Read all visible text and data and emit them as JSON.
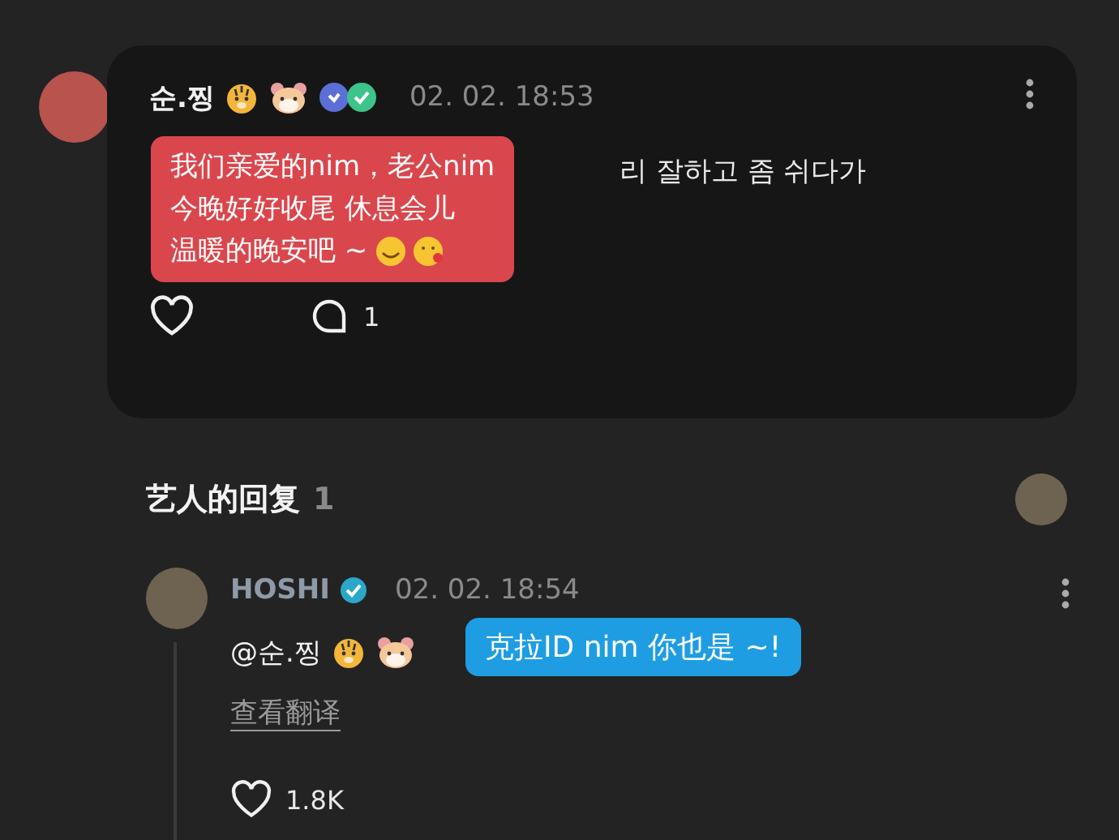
{
  "comment": {
    "author": "순.찡",
    "time": "02. 02. 18:53",
    "text_visible": "리 잘하고 좀 쉬다가",
    "translation_overlay": [
      "我们亲爱的nim，老公nim",
      "今晚好好收尾 休息会儿",
      "温暖的晚安吧 ~"
    ],
    "replies_count": "1",
    "liked": false
  },
  "artist_replies": {
    "title": "艺人的回复",
    "count": "1"
  },
  "reply": {
    "author": "HOSHI",
    "verified": true,
    "time": "02. 02. 18:54",
    "mention": "@순.찡",
    "translation_overlay": "克拉ID nim 你也是 ~!",
    "translate_link": "查看翻译",
    "likes": "1.8K",
    "liked": false
  }
}
